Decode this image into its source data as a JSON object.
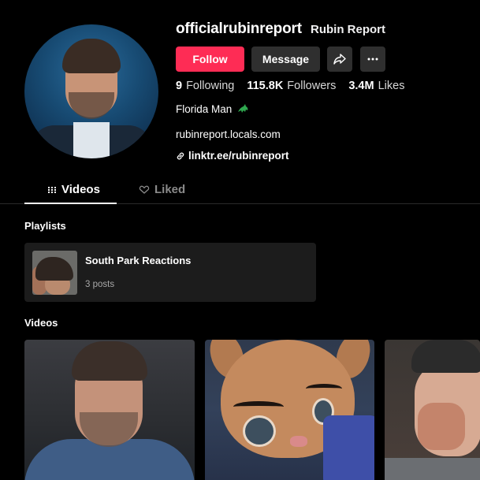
{
  "profile": {
    "username": "officialrubinreport",
    "nickname": "Rubin Report",
    "follow_label": "Follow",
    "message_label": "Message",
    "stats": [
      {
        "value": "9",
        "label": "Following"
      },
      {
        "value": "115.8K",
        "label": "Followers"
      },
      {
        "value": "3.4M",
        "label": "Likes"
      }
    ],
    "bio": "Florida Man",
    "bio_emoji": "alligator-icon",
    "website": "rubinreport.locals.com",
    "link": "linktr.ee/rubinreport"
  },
  "tabs": {
    "videos": "Videos",
    "liked": "Liked"
  },
  "playlists": {
    "title": "Playlists",
    "items": [
      {
        "name": "South Park Reactions",
        "count": "3 posts"
      }
    ]
  },
  "videos": {
    "title": "Videos"
  },
  "colors": {
    "accent": "#fe2c55",
    "background": "#000000",
    "button": "#2f2f2f",
    "card": "#1c1c1c"
  }
}
